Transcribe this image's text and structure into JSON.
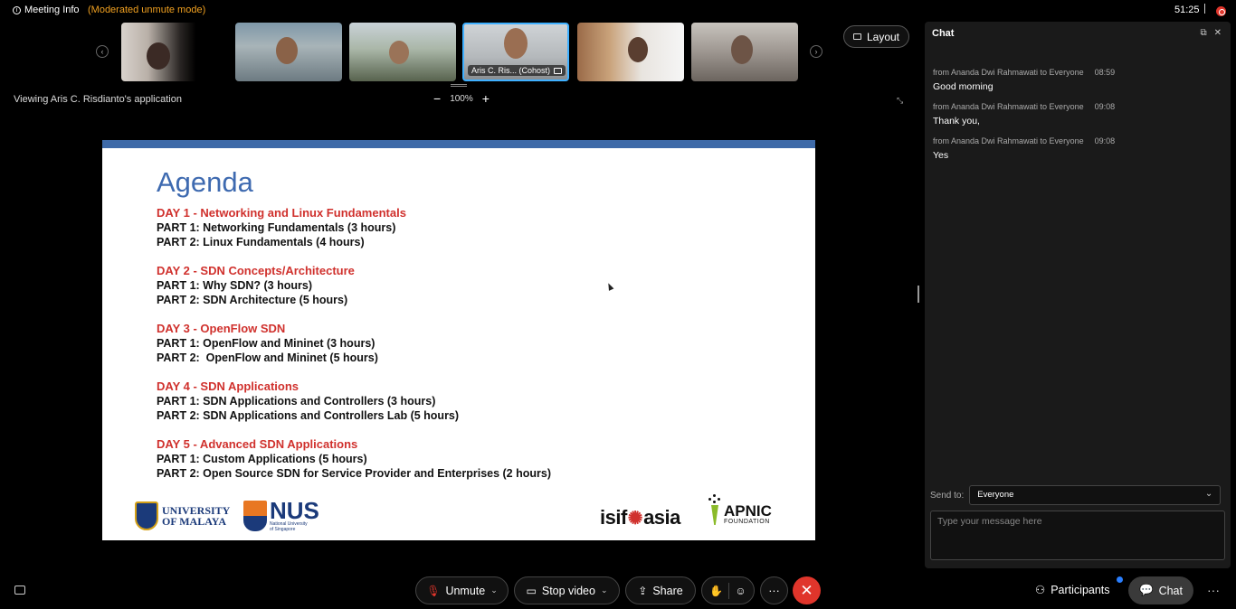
{
  "topbar": {
    "meeting_info": "Meeting Info",
    "moderated": "(Moderated unmute mode)",
    "timer": "51:25"
  },
  "strip": {
    "thumb4_label": "Aris C. Ris... (Cohost)"
  },
  "layout_button": "Layout",
  "share": {
    "viewing": "Viewing Aris C. Risdianto's application",
    "zoom_out": "−",
    "zoom_level": "100%",
    "zoom_in": "+"
  },
  "slide": {
    "title": "Agenda",
    "days": [
      {
        "title": "DAY 1 - Networking and Linux Fundamentals",
        "parts": [
          "PART 1: Networking Fundamentals (3 hours)",
          "PART 2: Linux Fundamentals (4 hours)"
        ]
      },
      {
        "title": "DAY 2 - SDN Concepts/Architecture",
        "parts": [
          "PART 1: Why SDN? (3 hours)",
          "PART 2: SDN Architecture (5 hours)"
        ]
      },
      {
        "title": "DAY 3 - OpenFlow SDN",
        "parts": [
          "PART 1: OpenFlow and Mininet (3 hours)",
          "PART 2:  OpenFlow and Mininet (5 hours)"
        ]
      },
      {
        "title": "DAY 4 - SDN Applications",
        "parts": [
          "PART 1: SDN Applications and Controllers (3 hours)",
          "PART 2: SDN Applications and Controllers Lab (5 hours)"
        ]
      },
      {
        "title": "DAY 5 - Advanced SDN Applications",
        "parts": [
          "PART 1: Custom Applications (5 hours)",
          "PART 2: Open Source SDN for Service Provider and Enterprises (2 hours)"
        ]
      }
    ],
    "logos": {
      "um_line1": "UNIVERSITY",
      "um_line2": "OF MALAYA",
      "nus": "NUS",
      "nus_sub1": "National University",
      "nus_sub2": "of Singapore",
      "isif_left": "isif",
      "isif_right": "asia",
      "apnic": "APNIC",
      "apnic_sub": "FOUNDATION"
    }
  },
  "chat": {
    "title": "Chat",
    "messages": [
      {
        "meta": "from Ananda Dwi Rahmawati to Everyone",
        "time": "08:59",
        "text": "Good morning"
      },
      {
        "meta": "from Ananda Dwi Rahmawati to Everyone",
        "time": "09:08",
        "text": "Thank you,"
      },
      {
        "meta": "from Ananda Dwi Rahmawati to Everyone",
        "time": "09:08",
        "text": "Yes"
      }
    ],
    "send_to_label": "Send to:",
    "send_to_value": "Everyone",
    "input_placeholder": "Type your message here"
  },
  "controls": {
    "unmute": "Unmute",
    "stop_video": "Stop video",
    "share": "Share",
    "more": "···",
    "participants": "Participants",
    "chat": "Chat",
    "overflow": "···"
  },
  "colors": {
    "accent_red": "#e0352b",
    "moderated_orange": "#f0a020",
    "slide_title_blue": "#3e6ab0",
    "day_title_red": "#d0312d",
    "active_border": "#3fb0ff"
  }
}
